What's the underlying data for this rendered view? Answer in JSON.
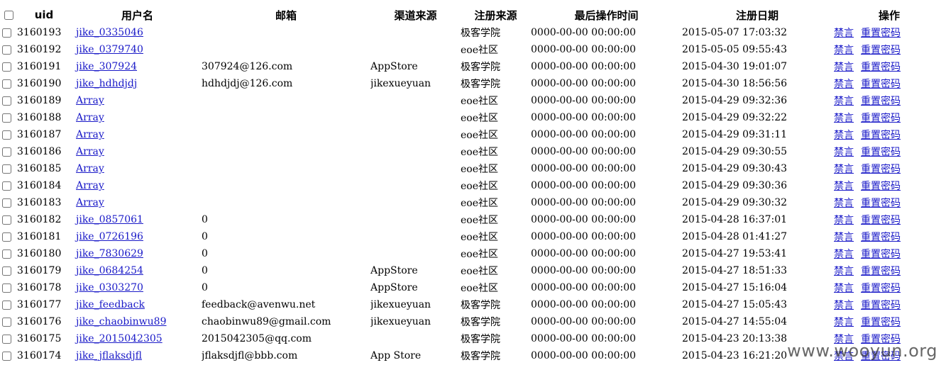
{
  "table": {
    "columns": {
      "uid": "uid",
      "username": "用户名",
      "email": "邮箱",
      "channel": "渠道来源",
      "reg_source": "注册来源",
      "last_op": "最后操作时间",
      "reg_date": "注册日期",
      "actions": "操作"
    },
    "action_ban": "禁言",
    "action_reset": "重置密码",
    "rows": [
      {
        "uid": "3160193",
        "username": "jike_0335046",
        "email": "",
        "channel": "",
        "reg_source": "极客学院",
        "last_op": "0000-00-00 00:00:00",
        "reg_date": "2015-05-07 17:03:32"
      },
      {
        "uid": "3160192",
        "username": "jike_0379740",
        "email": "",
        "channel": "",
        "reg_source": "eoe社区",
        "last_op": "0000-00-00 00:00:00",
        "reg_date": "2015-05-05 09:55:43"
      },
      {
        "uid": "3160191",
        "username": "jike_307924",
        "email": "307924@126.com",
        "channel": "AppStore",
        "reg_source": "极客学院",
        "last_op": "0000-00-00 00:00:00",
        "reg_date": "2015-04-30 19:01:07"
      },
      {
        "uid": "3160190",
        "username": "jike_hdhdjdj",
        "email": "hdhdjdj@126.com",
        "channel": "jikexueyuan",
        "reg_source": "极客学院",
        "last_op": "0000-00-00 00:00:00",
        "reg_date": "2015-04-30 18:56:56"
      },
      {
        "uid": "3160189",
        "username": "Array",
        "email": "",
        "channel": "",
        "reg_source": "eoe社区",
        "last_op": "0000-00-00 00:00:00",
        "reg_date": "2015-04-29 09:32:36"
      },
      {
        "uid": "3160188",
        "username": "Array",
        "email": "",
        "channel": "",
        "reg_source": "eoe社区",
        "last_op": "0000-00-00 00:00:00",
        "reg_date": "2015-04-29 09:32:22"
      },
      {
        "uid": "3160187",
        "username": "Array",
        "email": "",
        "channel": "",
        "reg_source": "eoe社区",
        "last_op": "0000-00-00 00:00:00",
        "reg_date": "2015-04-29 09:31:11"
      },
      {
        "uid": "3160186",
        "username": "Array",
        "email": "",
        "channel": "",
        "reg_source": "eoe社区",
        "last_op": "0000-00-00 00:00:00",
        "reg_date": "2015-04-29 09:30:55"
      },
      {
        "uid": "3160185",
        "username": "Array",
        "email": "",
        "channel": "",
        "reg_source": "eoe社区",
        "last_op": "0000-00-00 00:00:00",
        "reg_date": "2015-04-29 09:30:43"
      },
      {
        "uid": "3160184",
        "username": "Array",
        "email": "",
        "channel": "",
        "reg_source": "eoe社区",
        "last_op": "0000-00-00 00:00:00",
        "reg_date": "2015-04-29 09:30:36"
      },
      {
        "uid": "3160183",
        "username": "Array",
        "email": "",
        "channel": "",
        "reg_source": "eoe社区",
        "last_op": "0000-00-00 00:00:00",
        "reg_date": "2015-04-29 09:30:32"
      },
      {
        "uid": "3160182",
        "username": "jike_0857061",
        "email": "0",
        "channel": "",
        "reg_source": "eoe社区",
        "last_op": "0000-00-00 00:00:00",
        "reg_date": "2015-04-28 16:37:01"
      },
      {
        "uid": "3160181",
        "username": "jike_0726196",
        "email": "0",
        "channel": "",
        "reg_source": "eoe社区",
        "last_op": "0000-00-00 00:00:00",
        "reg_date": "2015-04-28 01:41:27"
      },
      {
        "uid": "3160180",
        "username": "jike_7830629",
        "email": "0",
        "channel": "",
        "reg_source": "eoe社区",
        "last_op": "0000-00-00 00:00:00",
        "reg_date": "2015-04-27 19:53:41"
      },
      {
        "uid": "3160179",
        "username": "jike_0684254",
        "email": "0",
        "channel": "AppStore",
        "reg_source": "eoe社区",
        "last_op": "0000-00-00 00:00:00",
        "reg_date": "2015-04-27 18:51:33"
      },
      {
        "uid": "3160178",
        "username": "jike_0303270",
        "email": "0",
        "channel": "AppStore",
        "reg_source": "eoe社区",
        "last_op": "0000-00-00 00:00:00",
        "reg_date": "2015-04-27 15:16:04"
      },
      {
        "uid": "3160177",
        "username": "jike_feedback",
        "email": "feedback@avenwu.net",
        "channel": "jikexueyuan",
        "reg_source": "极客学院",
        "last_op": "0000-00-00 00:00:00",
        "reg_date": "2015-04-27 15:05:43"
      },
      {
        "uid": "3160176",
        "username": "jike_chaobinwu89",
        "email": "chaobinwu89@gmail.com",
        "channel": "jikexueyuan",
        "reg_source": "极客学院",
        "last_op": "0000-00-00 00:00:00",
        "reg_date": "2015-04-27 14:55:04"
      },
      {
        "uid": "3160175",
        "username": "jike_2015042305",
        "email": "2015042305@qq.com",
        "channel": "",
        "reg_source": "极客学院",
        "last_op": "0000-00-00 00:00:00",
        "reg_date": "2015-04-23 20:13:38"
      },
      {
        "uid": "3160174",
        "username": "jike_jflaksdjfl",
        "email": "jflaksdjfl@bbb.com",
        "channel": "App Store",
        "reg_source": "极客学院",
        "last_op": "0000-00-00 00:00:00",
        "reg_date": "2015-04-23 16:21:20"
      }
    ]
  },
  "watermark": "www.wooyun.org",
  "colors": {
    "link": "#1a1ac8"
  }
}
